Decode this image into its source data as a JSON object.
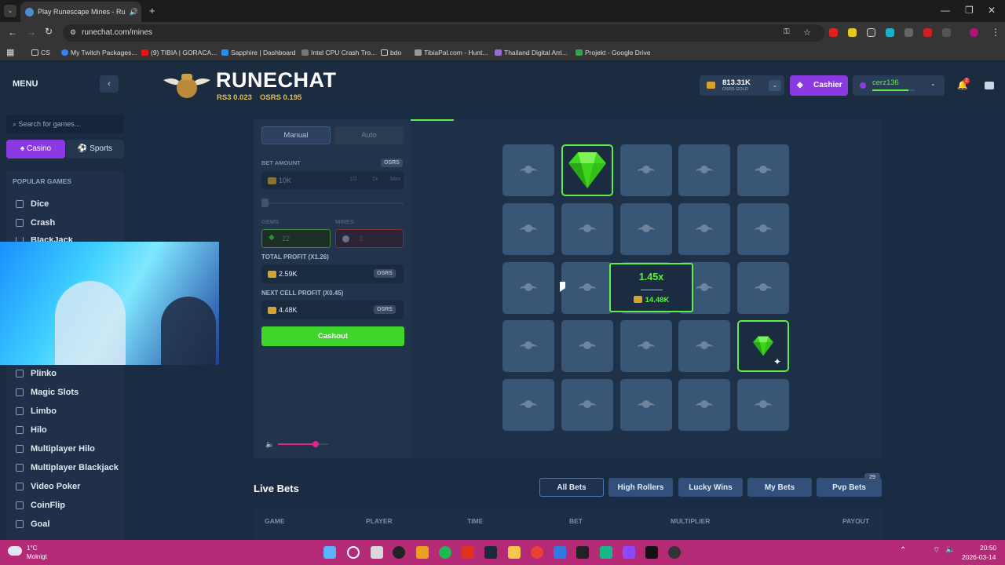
{
  "browser": {
    "tab_title": "Play Runescape Mines - Ru",
    "url": "runechat.com/mines",
    "bookmarks": [
      "CS",
      "My Twitch Packages...",
      "(9) TIBIA | GORACA...",
      "Sapphire | Dashboard",
      "Intel CPU Crash Tro...",
      "bdo",
      "TibiaPal.com - Hunt...",
      "Thailand Digital Arri...",
      "Projekt - Google Drive"
    ]
  },
  "sidebar": {
    "menu_label": "MENU",
    "search_placeholder": "Search for games...",
    "casino_label": "Casino",
    "sports_label": "Sports",
    "section_title": "POPULAR GAMES",
    "games": [
      "Dice",
      "Crash",
      "BlackJack",
      "Plinko",
      "Magic Slots",
      "Limbo",
      "Hilo",
      "Multiplayer Hilo",
      "Multiplayer Blackjack",
      "Video Poker",
      "CoinFlip",
      "Goal"
    ]
  },
  "header": {
    "brand": "RUNECHAT",
    "rs3_price": "RS3 0.023",
    "osrs_price": "OSRS 0.195",
    "balance": "813.31K",
    "balance_unit": "OSRS GOLD",
    "cashier_label": "Cashier",
    "username": "cerz136",
    "notification_count": "2"
  },
  "controls": {
    "tab_manual": "Manual",
    "tab_auto": "Auto",
    "bet_amount_label": "BET AMOUNT",
    "bet_currency": "OSRS",
    "bet_value": "10K",
    "half_label": "1/2",
    "double_label": "2x",
    "max_label": "Max",
    "gems_label": "GEMS",
    "gems_value": "22",
    "mines_label": "MINES",
    "mines_value": "3",
    "total_profit_label": "TOTAL PROFIT (X1.26)",
    "total_profit_value": "2.59K",
    "next_profit_label": "NEXT CELL PROFIT (X0.45)",
    "next_profit_value": "4.48K",
    "profit_currency": "OSRS",
    "cashout_label": "Cashout",
    "volume_level": 0.75
  },
  "board": {
    "rows": 5,
    "cols": 5,
    "revealed_gems": [
      [
        0,
        1
      ],
      [
        3,
        4
      ]
    ],
    "popup_multiplier": "1.45x",
    "popup_amount": "14.48K",
    "accent_color": "#5df044"
  },
  "live_bets": {
    "title": "Live Bets",
    "tabs": [
      "All Bets",
      "High Rollers",
      "Lucky Wins",
      "My Bets",
      "Pvp Bets"
    ],
    "pvp_badge": "29",
    "columns": [
      "GAME",
      "PLAYER",
      "TIME",
      "BET",
      "MULTIPLIER",
      "PAYOUT"
    ]
  },
  "taskbar": {
    "weather_temp": "1°C",
    "weather_desc": "Molnigt",
    "time": "20:50",
    "date": "2026-03-14"
  }
}
